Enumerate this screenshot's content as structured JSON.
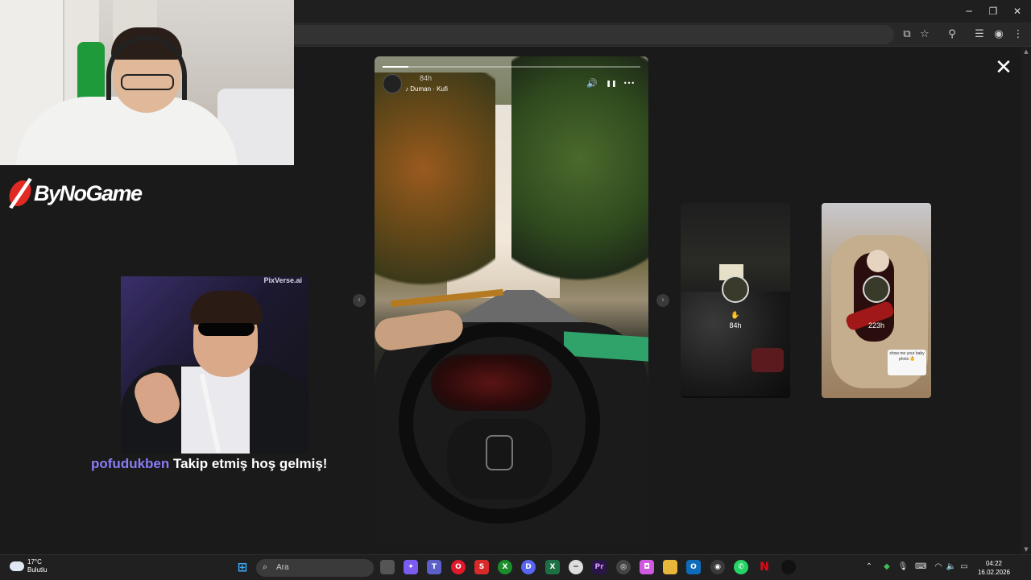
{
  "browser": {
    "window_controls": {
      "minimize": "─",
      "restore": "❐",
      "close": "✕"
    },
    "toolbar_icons": [
      "cast-icon",
      "bookmark-star-icon",
      "extensions-icon",
      "reading-list-icon",
      "profile-icon",
      "menu-icon"
    ]
  },
  "stream_overlay": {
    "logo_text": "ByNoGame",
    "alert": {
      "username": "pofudukben",
      "message": " Takip etmiş hoş gelmiş!",
      "watermark": "PixVerse.ai"
    }
  },
  "story_viewer": {
    "close_label": "✕",
    "main_story": {
      "time": "84h",
      "music": "Duman · Kufi",
      "progress": 0.1,
      "controls": {
        "sound": "🔊",
        "pause": "❚❚",
        "more": "•••"
      }
    },
    "prev_arrow": "‹",
    "next_arrow": "›",
    "thumbnails": [
      {
        "time": "84h"
      },
      {
        "time": "223h",
        "sticker_text": "show me your baby photo 👶"
      }
    ]
  },
  "taskbar": {
    "weather": {
      "temp": "17°C",
      "condition": "Bulutlu"
    },
    "search_placeholder": "Ara",
    "clock": {
      "time": "04:22",
      "date": "16.02.2026"
    },
    "colors": {
      "windows": "#3ea8f5",
      "copilot": "#7b5cf0",
      "teams": "#5b5fc7",
      "opera": "#e2182b",
      "swift": "#d92a2a",
      "xbox": "#1b8e2a",
      "discord": "#5865f2",
      "excel": "#1d7044",
      "premiere": "#2a1548",
      "outlook": "#0f6cbd",
      "whatsapp": "#25d366",
      "netflix": "#e50914"
    }
  }
}
